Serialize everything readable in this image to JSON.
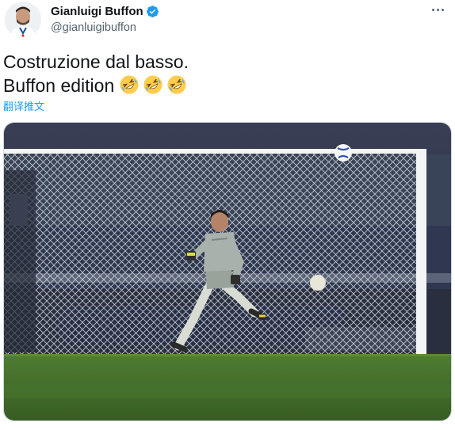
{
  "user": {
    "display_name": "Gianluigi Buffon",
    "handle": "@gianluigibuffon",
    "verified": true
  },
  "tweet": {
    "line1": "Costruzione dal basso.",
    "line2": "Buffon edition",
    "emojis": [
      "rolling-on-floor-laughing",
      "rolling-on-floor-laughing",
      "rolling-on-floor-laughing"
    ],
    "translate_label": "翻译推文"
  },
  "media": {
    "type": "photo"
  },
  "colors": {
    "accent": "#1d9bf0",
    "verified": "#1d9bf0",
    "pitch": "#3f6b2a",
    "stadium": "#2b2f3a"
  }
}
